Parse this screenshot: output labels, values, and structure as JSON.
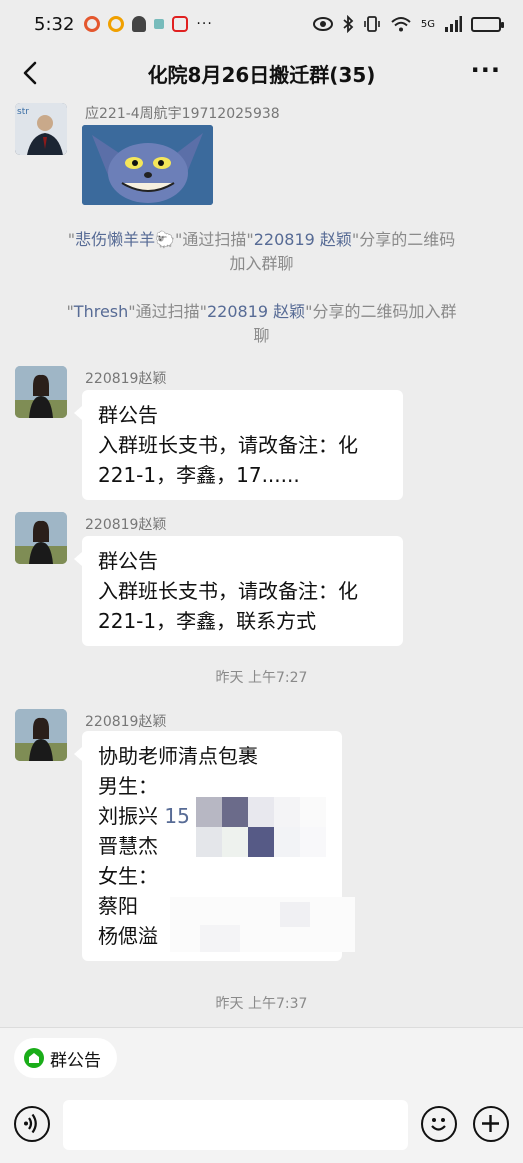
{
  "status": {
    "time": "5:32",
    "more": "···",
    "network": "5G"
  },
  "header": {
    "title": "化院8月26日搬迁群(35)"
  },
  "messages": [
    {
      "sender": "应221-4周航宇19712025938",
      "type": "image",
      "image_desc": "cartoon cat sticker"
    },
    {
      "type": "system",
      "line1": {
        "q1": "\"",
        "name": "悲伤懒羊羊🐑",
        "q2": "\"通过扫描\"",
        "name2": "220819 赵颖",
        "q3": "\"分享的二维码"
      },
      "line2": "加入群聊"
    },
    {
      "type": "system",
      "line1": {
        "q1": "\"",
        "name": "Thresh",
        "q2": "\"通过扫描\"",
        "name2": "220819 赵颖",
        "q3": "\"分享的二维码加入群"
      },
      "line2": "聊"
    },
    {
      "sender": "220819赵颖",
      "type": "text",
      "lines": [
        "群公告",
        "入群班长支书，请改备注：化",
        "221-1，李鑫，17......"
      ]
    },
    {
      "sender": "220819赵颖",
      "type": "text",
      "lines": [
        "群公告",
        "入群班长支书，请改备注：化",
        "221-1，李鑫，联系方式"
      ]
    },
    {
      "type": "time",
      "text": "昨天 上午7:27"
    },
    {
      "sender": "220819赵颖",
      "type": "text",
      "lines": [
        "协助老师清点包裹",
        "男生：",
        "刘振兴",
        "晋慧杰",
        "女生：",
        "蔡阳",
        "杨偲溢"
      ],
      "phone_prefix": "15"
    },
    {
      "type": "time",
      "text": "昨天 上午7:37"
    }
  ],
  "footer": {
    "announcement_label": "群公告"
  },
  "colors": {
    "background": "#ededed",
    "link": "#576b95",
    "bubble": "#ffffff"
  }
}
